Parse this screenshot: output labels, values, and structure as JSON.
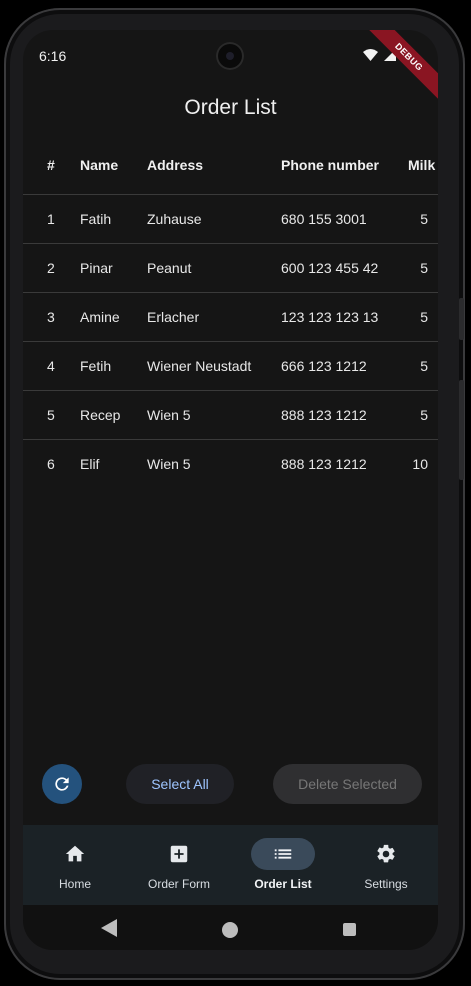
{
  "status_bar": {
    "time": "6:16",
    "debug_label": "DEBUG"
  },
  "page": {
    "title": "Order List"
  },
  "table": {
    "headers": {
      "num": "#",
      "name": "Name",
      "address": "Address",
      "phone": "Phone number",
      "milk": "Milk"
    },
    "rows": [
      {
        "num": "1",
        "name": "Fatih",
        "address": "Zuhause",
        "phone": "680 155 3001",
        "milk": "5"
      },
      {
        "num": "2",
        "name": "Pinar",
        "address": "Peanut",
        "phone": "600 123 455 42",
        "milk": "5"
      },
      {
        "num": "3",
        "name": "Amine",
        "address": "Erlacher",
        "phone": "123 123 123 13",
        "milk": "5"
      },
      {
        "num": "4",
        "name": "Fetih",
        "address": "Wiener Neustadt",
        "phone": "666 123 1212",
        "milk": "5"
      },
      {
        "num": "5",
        "name": "Recep",
        "address": "Wien 5",
        "phone": "888 123 1212",
        "milk": "5"
      },
      {
        "num": "6",
        "name": "Elif",
        "address": "Wien 5",
        "phone": "888 123 1212",
        "milk": "10"
      }
    ]
  },
  "actions": {
    "refresh_icon": "refresh-icon",
    "select_all_label": "Select All",
    "delete_selected_label": "Delete Selected"
  },
  "nav": {
    "items": [
      {
        "label": "Home",
        "icon": "home-icon"
      },
      {
        "label": "Order Form",
        "icon": "add-box-icon"
      },
      {
        "label": "Order List",
        "icon": "list-icon",
        "active": true
      },
      {
        "label": "Settings",
        "icon": "gear-icon"
      }
    ]
  },
  "colors": {
    "background": "#151515",
    "accent": "#24527d",
    "select_text": "#9ec5ff",
    "navbar": "#1b2226",
    "debug_ribbon": "#8a1522"
  }
}
